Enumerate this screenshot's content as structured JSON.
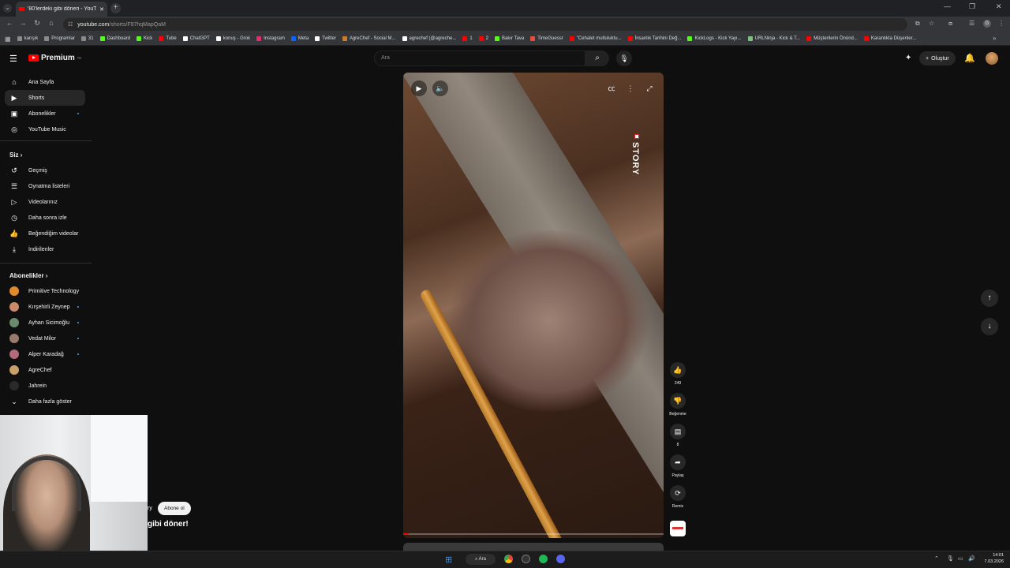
{
  "browser": {
    "tab_title": "'80'lerdeki gibi döneri - YouTube",
    "tab_close": "✕",
    "new_tab": "+",
    "url_host": "youtube.com",
    "url_path": "/shorts/F97hqMapQaM",
    "profile_initial": "G",
    "bookmarks": [
      {
        "label": "karışık",
        "color": "#8a8a8a"
      },
      {
        "label": "Programlar",
        "color": "#8a8a8a"
      },
      {
        "label": "31",
        "color": "#8a8a8a"
      },
      {
        "label": "Dashboard",
        "color": "#53fc18"
      },
      {
        "label": "Kick",
        "color": "#53fc18"
      },
      {
        "label": "Tube",
        "color": "#ff0000"
      },
      {
        "label": "ChatGPT",
        "color": "#ffffff"
      },
      {
        "label": "konuş - Grok",
        "color": "#ffffff"
      },
      {
        "label": "Instagram",
        "color": "#e1306c"
      },
      {
        "label": "Meta",
        "color": "#0866ff"
      },
      {
        "label": "Twitter",
        "color": "#ffffff"
      },
      {
        "label": "AgreChef - Social M...",
        "color": "#c77d2a"
      },
      {
        "label": "agrechef (@agreche...",
        "color": "#ffffff"
      },
      {
        "label": "1",
        "color": "#ff0000"
      },
      {
        "label": "2",
        "color": "#ff0000"
      },
      {
        "label": "Bakır Tava",
        "color": "#53fc18"
      },
      {
        "label": "TimeGuessr",
        "color": "#e84c3d"
      },
      {
        "label": "\"Cehalet mutluluktu...",
        "color": "#ff0000"
      },
      {
        "label": "İnsanlık Tarihini Değ...",
        "color": "#ff0000"
      },
      {
        "label": "KickLogs - Kick Yayı...",
        "color": "#53fc18"
      },
      {
        "label": "URLNinja - Kick & T...",
        "color": "#7fbf7f"
      },
      {
        "label": "Müşterilerin Önünd...",
        "color": "#ff0000"
      },
      {
        "label": "Karanlıkta Düşenler...",
        "color": "#ff0000"
      }
    ]
  },
  "masthead": {
    "logo_label": "Premium",
    "logo_sup": "TR",
    "search_placeholder": "Ara",
    "create_label": "Oluştur"
  },
  "sidebar": {
    "main": [
      {
        "label": "Ana Sayfa",
        "icon": "home-icon",
        "glyph": "⌂"
      },
      {
        "label": "Shorts",
        "icon": "shorts-icon",
        "glyph": "▶",
        "active": true
      },
      {
        "label": "Abonelikler",
        "icon": "subscriptions-icon",
        "glyph": "▣",
        "dot": true
      },
      {
        "label": "YouTube Music",
        "icon": "music-icon",
        "glyph": "◎"
      }
    ],
    "you_header": "Siz",
    "you": [
      {
        "label": "Geçmiş",
        "icon": "history-icon",
        "glyph": "↺"
      },
      {
        "label": "Oynatma listeleri",
        "icon": "playlists-icon",
        "glyph": "☰"
      },
      {
        "label": "Videolarınız",
        "icon": "your-videos-icon",
        "glyph": "▷"
      },
      {
        "label": "Daha sonra izle",
        "icon": "watch-later-icon",
        "glyph": "◷"
      },
      {
        "label": "Beğendiğim videolar",
        "icon": "liked-icon",
        "glyph": "👍"
      },
      {
        "label": "İndirilenler",
        "icon": "downloads-icon",
        "glyph": "⤓"
      }
    ],
    "subs_header": "Abonelikler",
    "subs": [
      {
        "label": "Primitive Technology",
        "color": "#e08a2a",
        "dot": false
      },
      {
        "label": "Kırşehirli Zeynep",
        "color": "#c98a6a",
        "dot": true
      },
      {
        "label": "Ayhan Sicimoğlu",
        "color": "#6b8a6b",
        "dot": true
      },
      {
        "label": "Vedat Milor",
        "color": "#9a7a6a",
        "dot": true
      },
      {
        "label": "Alper Karadağ",
        "color": "#b06a7a",
        "dot": true
      },
      {
        "label": "AgreChef",
        "color": "#c9a06a",
        "dot": false
      },
      {
        "label": "Jahrein",
        "color": "#2a2a2a",
        "dot": false
      }
    ],
    "show_more": "Daha fazla göster"
  },
  "video": {
    "overlay_brand": "STORY",
    "progress": 0.02,
    "channel_partial": "ry",
    "subscribe_label": "Abone ol",
    "title_partial": "gibi döner!"
  },
  "actions": {
    "like_count": "249",
    "dislike_label": "Beğenme",
    "comment_count": "8",
    "share_label": "Paylaş",
    "remix_label": "Remix"
  },
  "taskbar": {
    "search_label": "Ara",
    "time": "14:01",
    "date": "7.03.2026"
  }
}
